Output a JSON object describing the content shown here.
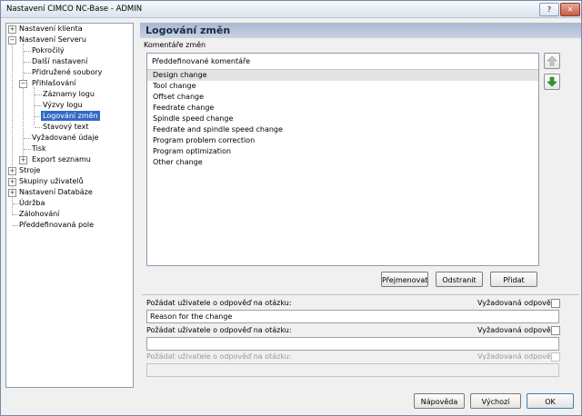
{
  "window": {
    "title": "Nastavení CIMCO NC-Base - ADMIN",
    "help_label": "?",
    "close_label": "✕"
  },
  "tree": [
    {
      "label": "Nastavení klienta",
      "level": 0,
      "expander": "+"
    },
    {
      "label": "Nastavení Serveru",
      "level": 0,
      "expander": "−"
    },
    {
      "label": "Pokročilý",
      "level": 1
    },
    {
      "label": "Další nastavení",
      "level": 1
    },
    {
      "label": "Přidružené soubory",
      "level": 1
    },
    {
      "label": "Přihlašování",
      "level": 1,
      "expander": "−"
    },
    {
      "label": "Záznamy logu",
      "level": 2
    },
    {
      "label": "Výzvy logu",
      "level": 2
    },
    {
      "label": "Logování změn",
      "level": 2,
      "selected": true
    },
    {
      "label": "Stavový text",
      "level": 2
    },
    {
      "label": "Vyžadované údaje",
      "level": 1
    },
    {
      "label": "Tisk",
      "level": 1
    },
    {
      "label": "Export seznamu",
      "level": 1,
      "expander": "+"
    },
    {
      "label": "Stroje",
      "level": 0,
      "expander": "+"
    },
    {
      "label": "Skupiny uživatelů",
      "level": 0,
      "expander": "+"
    },
    {
      "label": "Nastavení Databáze",
      "level": 0,
      "expander": "+"
    },
    {
      "label": "Údržba",
      "level": 0
    },
    {
      "label": "Zálohování",
      "level": 0
    },
    {
      "label": "Předdefinovaná pole",
      "level": 0
    }
  ],
  "header": {
    "title": "Logování změn"
  },
  "comments": {
    "group_label": "Komentáře změn",
    "column_header": "Předdefinované komentáře",
    "items": [
      "Design change",
      "Tool change",
      "Offset change",
      "Feedrate change",
      "Spindle speed change",
      "Feedrate and spindle speed change",
      "Program problem correction",
      "Program optimization",
      "Other change"
    ],
    "selected_index": 0,
    "rename_label": "Přejmenovat",
    "remove_label": "Odstranit",
    "add_label": "Přidat"
  },
  "questions": [
    {
      "label": "Požádat uživatele o odpověď na otázku:",
      "required_label": "Vyžadovaná odpověď",
      "value": "Reason for the change",
      "enabled": true
    },
    {
      "label": "Požádat uživatele o odpověď na otázku:",
      "required_label": "Vyžadovaná odpověď",
      "value": "",
      "enabled": true
    },
    {
      "label": "Požádat uživatele o odpověď na otázku:",
      "required_label": "Vyžadovaná odpověď",
      "value": "",
      "enabled": false
    }
  ],
  "footer": {
    "help_label": "Nápověda",
    "default_label": "Výchozí",
    "ok_label": "OK"
  },
  "colors": {
    "selection": "#3169c6",
    "header_bg": "#b9c6d9",
    "arrow_green": "#2e9a2e"
  }
}
